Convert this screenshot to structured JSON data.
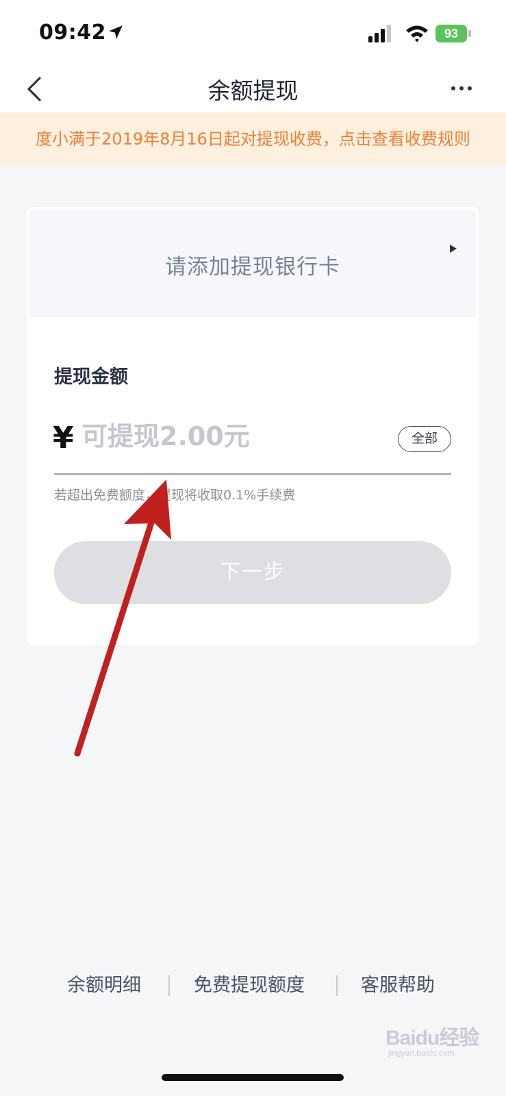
{
  "status_bar": {
    "time": "09:42",
    "battery": "93",
    "icons": [
      "location-arrow-icon",
      "signal-icon",
      "wifi-icon",
      "battery-icon"
    ]
  },
  "nav": {
    "title": "余额提现",
    "back_icon": "chevron-left-icon",
    "more_icon": "more-dots-icon"
  },
  "notice": {
    "text": "度小满于2019年8月16日起对提现收费，点击查看收费规则"
  },
  "card": {
    "bank_prompt": "请添加提现银行卡",
    "amount_title": "提现金额",
    "currency_symbol": "¥",
    "amount_placeholder": "可提现2.00元",
    "amount_value": "",
    "all_button": "全部",
    "fee_note": "若超出免费额度，提现将收取0.1%手续费",
    "next_button": "下一步"
  },
  "bottom_links": {
    "balance_detail": "余额明细",
    "free_quota": "免费提现额度",
    "customer_service": "客服帮助"
  },
  "watermark": {
    "main": "Baidu经验",
    "sub": "jingyan.baidu.com"
  },
  "colors": {
    "notice_bg": "#fdf0df",
    "notice_text": "#f07f35",
    "annotation_arrow": "#c0201e",
    "battery": "#5cc25c",
    "disabled_button": "#dddfe3"
  }
}
